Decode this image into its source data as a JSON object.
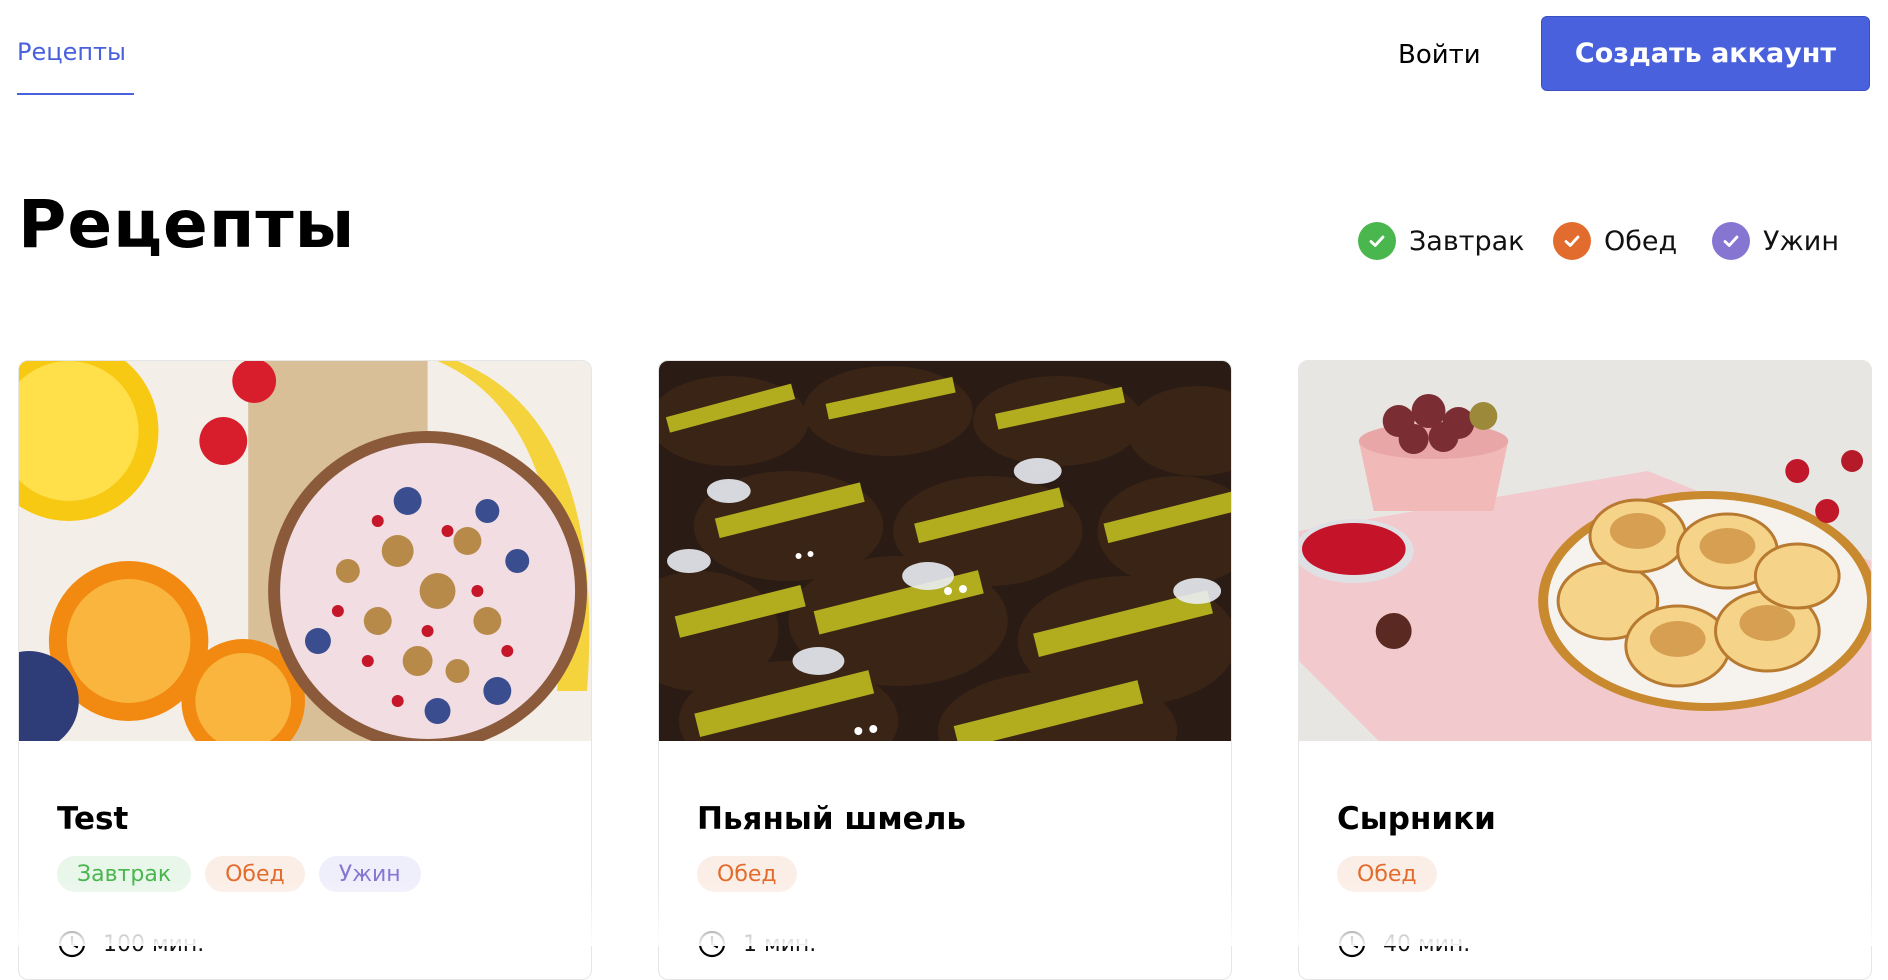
{
  "header": {
    "nav_recipes": "Рецепты",
    "login_label": "Войти",
    "create_account_label": "Создать аккаунт"
  },
  "page": {
    "title": "Рецепты"
  },
  "filters": [
    {
      "label": "Завтрак",
      "color": "#49b64e",
      "checked": true
    },
    {
      "label": "Обед",
      "color": "#e26c2d",
      "checked": true
    },
    {
      "label": "Ужин",
      "color": "#8775d2",
      "checked": true
    }
  ],
  "cards": [
    {
      "title": "Test",
      "image": "breakfast-bowl-with-granola-berries-orange-juice",
      "tags": [
        "Завтрак",
        "Обед",
        "Ужин"
      ],
      "time": "100 мин."
    },
    {
      "title": "Пьяный шмель",
      "image": "bumblebee-shaped-chocolate-cakes",
      "tags": [
        "Обед"
      ],
      "time": "1 мин."
    },
    {
      "title": "Сырники",
      "image": "syrniki-cheese-pancakes-on-plate",
      "tags": [
        "Обед"
      ],
      "time": "40 мин."
    }
  ],
  "colors": {
    "accent": "#4a61dd",
    "breakfast": "#49b64e",
    "lunch": "#e26c2d",
    "dinner": "#8775d2"
  },
  "icons": {
    "filter_check": "check-icon",
    "card_time": "clock-icon"
  }
}
